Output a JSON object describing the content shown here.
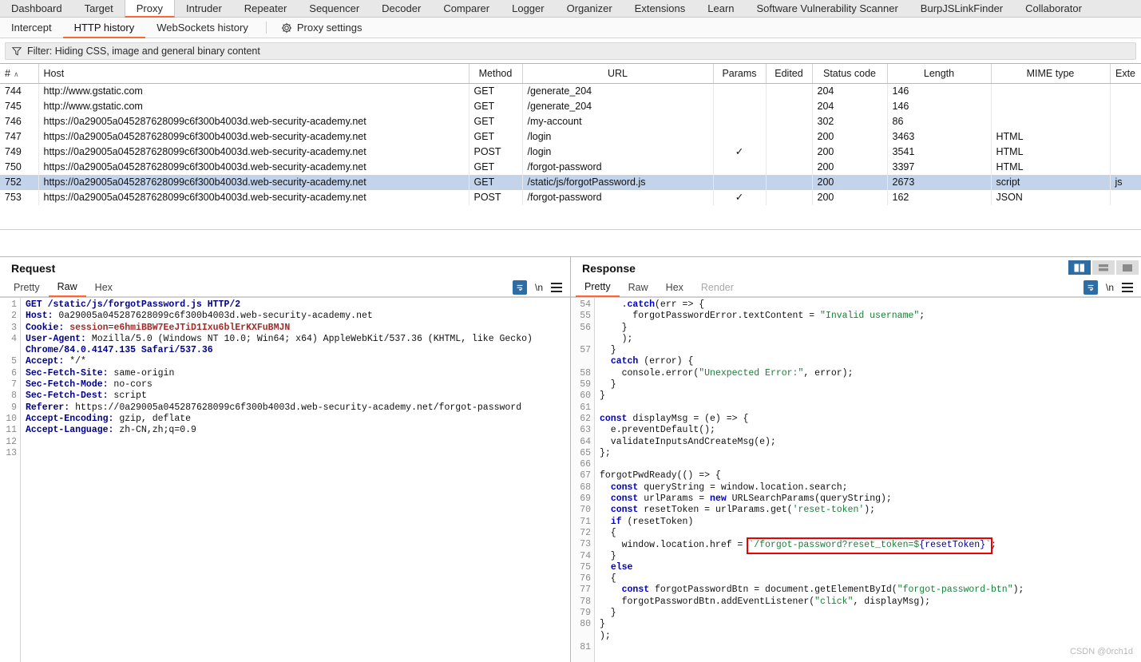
{
  "main_tabs": [
    {
      "label": "Dashboard",
      "active": false
    },
    {
      "label": "Target",
      "active": false
    },
    {
      "label": "Proxy",
      "active": true
    },
    {
      "label": "Intruder",
      "active": false
    },
    {
      "label": "Repeater",
      "active": false
    },
    {
      "label": "Sequencer",
      "active": false
    },
    {
      "label": "Decoder",
      "active": false
    },
    {
      "label": "Comparer",
      "active": false
    },
    {
      "label": "Logger",
      "active": false
    },
    {
      "label": "Organizer",
      "active": false
    },
    {
      "label": "Extensions",
      "active": false
    },
    {
      "label": "Learn",
      "active": false
    },
    {
      "label": "Software Vulnerability Scanner",
      "active": false
    },
    {
      "label": "BurpJSLinkFinder",
      "active": false
    },
    {
      "label": "Collaborator",
      "active": false
    }
  ],
  "sub_tabs": [
    {
      "label": "Intercept",
      "active": false
    },
    {
      "label": "HTTP history",
      "active": true
    },
    {
      "label": "WebSockets history",
      "active": false
    }
  ],
  "proxy_settings": {
    "label": "Proxy settings",
    "icon": "gear-icon"
  },
  "filter": {
    "icon": "funnel-icon",
    "text": "Filter: Hiding CSS, image and general binary content"
  },
  "history_table": {
    "columns": [
      "#",
      "Host",
      "Method",
      "URL",
      "Params",
      "Edited",
      "Status code",
      "Length",
      "MIME type",
      "Exte"
    ],
    "sort_indicator": "∧",
    "rows": [
      {
        "num": "744",
        "host": "http://www.gstatic.com",
        "method": "GET",
        "url": "/generate_204",
        "params": "",
        "edited": "",
        "status": "204",
        "length": "146",
        "mime": "",
        "ext": "",
        "selected": false
      },
      {
        "num": "745",
        "host": "http://www.gstatic.com",
        "method": "GET",
        "url": "/generate_204",
        "params": "",
        "edited": "",
        "status": "204",
        "length": "146",
        "mime": "",
        "ext": "",
        "selected": false
      },
      {
        "num": "746",
        "host": "https://0a29005a045287628099c6f300b4003d.web-security-academy.net",
        "method": "GET",
        "url": "/my-account",
        "params": "",
        "edited": "",
        "status": "302",
        "length": "86",
        "mime": "",
        "ext": "",
        "selected": false
      },
      {
        "num": "747",
        "host": "https://0a29005a045287628099c6f300b4003d.web-security-academy.net",
        "method": "GET",
        "url": "/login",
        "params": "",
        "edited": "",
        "status": "200",
        "length": "3463",
        "mime": "HTML",
        "ext": "",
        "selected": false
      },
      {
        "num": "749",
        "host": "https://0a29005a045287628099c6f300b4003d.web-security-academy.net",
        "method": "POST",
        "url": "/login",
        "params": "✓",
        "edited": "",
        "status": "200",
        "length": "3541",
        "mime": "HTML",
        "ext": "",
        "selected": false
      },
      {
        "num": "750",
        "host": "https://0a29005a045287628099c6f300b4003d.web-security-academy.net",
        "method": "GET",
        "url": "/forgot-password",
        "params": "",
        "edited": "",
        "status": "200",
        "length": "3397",
        "mime": "HTML",
        "ext": "",
        "selected": false
      },
      {
        "num": "752",
        "host": "https://0a29005a045287628099c6f300b4003d.web-security-academy.net",
        "method": "GET",
        "url": "/static/js/forgotPassword.js",
        "params": "",
        "edited": "",
        "status": "200",
        "length": "2673",
        "mime": "script",
        "ext": "js",
        "selected": true
      },
      {
        "num": "753",
        "host": "https://0a29005a045287628099c6f300b4003d.web-security-academy.net",
        "method": "POST",
        "url": "/forgot-password",
        "params": "✓",
        "edited": "",
        "status": "200",
        "length": "162",
        "mime": "JSON",
        "ext": "",
        "selected": false
      }
    ]
  },
  "request_pane": {
    "title": "Request",
    "tabs": [
      {
        "label": "Pretty",
        "active": false,
        "disabled": false
      },
      {
        "label": "Raw",
        "active": true,
        "disabled": false
      },
      {
        "label": "Hex",
        "active": false,
        "disabled": false
      }
    ],
    "tools": [
      {
        "name": "word-wrap-icon"
      },
      {
        "name": "newline-icon",
        "label": "\\n"
      },
      {
        "name": "menu-icon"
      }
    ],
    "lines": [
      {
        "n": "1",
        "text": "GET /static/js/forgotPassword.js HTTP/2"
      },
      {
        "n": "2",
        "text": "Host: 0a29005a045287628099c6f300b4003d.web-security-academy.net"
      },
      {
        "n": "3",
        "text": "Cookie: session=e6hmiBBW7EeJTiD1Ixu6blErKXFuBMJN"
      },
      {
        "n": "4",
        "text": "User-Agent: Mozilla/5.0 (Windows NT 10.0; Win64; x64) AppleWebKit/537.36 (KHTML, like Gecko)"
      },
      {
        "n": "",
        "text": "Chrome/84.0.4147.135 Safari/537.36"
      },
      {
        "n": "5",
        "text": "Accept: */*"
      },
      {
        "n": "6",
        "text": "Sec-Fetch-Site: same-origin"
      },
      {
        "n": "7",
        "text": "Sec-Fetch-Mode: no-cors"
      },
      {
        "n": "8",
        "text": "Sec-Fetch-Dest: script"
      },
      {
        "n": "9",
        "text": "Referer: https://0a29005a045287628099c6f300b4003d.web-security-academy.net/forgot-password"
      },
      {
        "n": "10",
        "text": "Accept-Encoding: gzip, deflate"
      },
      {
        "n": "11",
        "text": "Accept-Language: zh-CN,zh;q=0.9"
      },
      {
        "n": "12",
        "text": ""
      },
      {
        "n": "13",
        "text": ""
      }
    ]
  },
  "response_pane": {
    "title": "Response",
    "tabs": [
      {
        "label": "Pretty",
        "active": true,
        "disabled": false
      },
      {
        "label": "Raw",
        "active": false,
        "disabled": false
      },
      {
        "label": "Hex",
        "active": false,
        "disabled": false
      },
      {
        "label": "Render",
        "active": false,
        "disabled": true
      }
    ],
    "tools": [
      {
        "name": "word-wrap-icon"
      },
      {
        "name": "newline-icon",
        "label": "\\n"
      },
      {
        "name": "menu-icon"
      }
    ],
    "view_toggle": [
      {
        "name": "split-vertical-view",
        "active": true
      },
      {
        "name": "split-horizontal-view",
        "active": false
      },
      {
        "name": "single-view",
        "active": false
      }
    ],
    "lines": [
      {
        "n": "54",
        "text": "    .catch(err => {"
      },
      {
        "n": "55",
        "text": "      forgotPasswordError.textContent = \"Invalid username\";"
      },
      {
        "n": "56",
        "text": "    }"
      },
      {
        "n": "",
        "text": "    );"
      },
      {
        "n": "57",
        "text": "  }"
      },
      {
        "n": "",
        "text": "  catch (error) {"
      },
      {
        "n": "58",
        "text": "    console.error(\"Unexpected Error:\", error);"
      },
      {
        "n": "59",
        "text": "  }"
      },
      {
        "n": "60",
        "text": "}"
      },
      {
        "n": "61",
        "text": ""
      },
      {
        "n": "62",
        "text": "const displayMsg = (e) => {"
      },
      {
        "n": "63",
        "text": "  e.preventDefault();"
      },
      {
        "n": "64",
        "text": "  validateInputsAndCreateMsg(e);"
      },
      {
        "n": "65",
        "text": "};"
      },
      {
        "n": "66",
        "text": ""
      },
      {
        "n": "67",
        "text": "forgotPwdReady(() => {"
      },
      {
        "n": "68",
        "text": "  const queryString = window.location.search;"
      },
      {
        "n": "69",
        "text": "  const urlParams = new URLSearchParams(queryString);"
      },
      {
        "n": "70",
        "text": "  const resetToken = urlParams.get('reset-token');"
      },
      {
        "n": "71",
        "text": "  if (resetToken)"
      },
      {
        "n": "72",
        "text": "  {"
      },
      {
        "n": "73",
        "text": "    window.location.href = `/forgot-password?reset_token=${resetToken}`;"
      },
      {
        "n": "74",
        "text": "  }"
      },
      {
        "n": "75",
        "text": "  else"
      },
      {
        "n": "76",
        "text": "  {"
      },
      {
        "n": "77",
        "text": "    const forgotPasswordBtn = document.getElementById(\"forgot-password-btn\");"
      },
      {
        "n": "78",
        "text": "    forgotPasswordBtn.addEventListener(\"click\", displayMsg);"
      },
      {
        "n": "79",
        "text": "  }"
      },
      {
        "n": "80",
        "text": "}"
      },
      {
        "n": "",
        "text": ");"
      },
      {
        "n": "81",
        "text": ""
      }
    ],
    "highlight": {
      "line": "73",
      "text": "/forgot-password?reset_token=${resetToken}"
    }
  },
  "watermark": "CSDN @0rch1d",
  "colors": {
    "accent": "#ff6633",
    "selection": "#c3d3ea",
    "tool_blue": "#2e6da4",
    "highlight_box": "#ee0000",
    "string_green": "#1a7f37",
    "keyword_blue": "#0000cd",
    "header_darkblue": "#00008b",
    "cookie_red": "#a52a2a"
  }
}
